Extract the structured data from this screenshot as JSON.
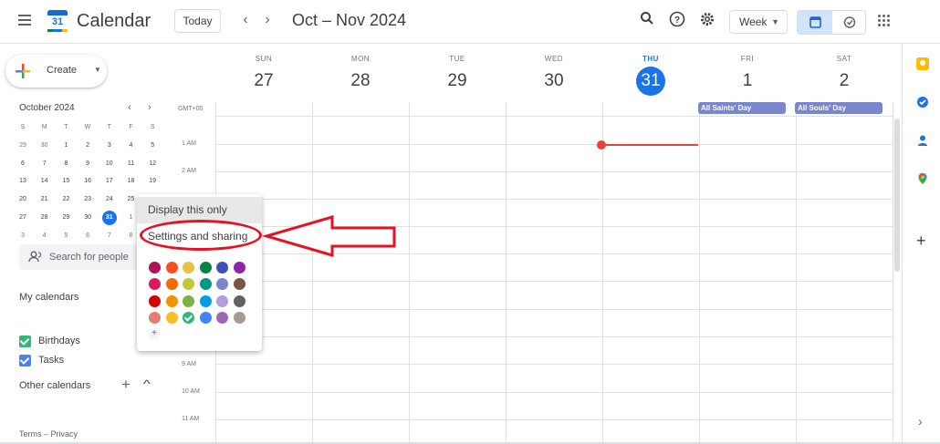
{
  "header": {
    "app_title": "Calendar",
    "logo_number": "31",
    "today_label": "Today",
    "prev_icon": "chevron-left-icon",
    "next_icon": "chevron-right-icon",
    "range_title": "Oct – Nov 2024",
    "search_icon": "search-icon",
    "help_icon": "help-icon",
    "settings_icon": "gear-icon",
    "view_label": "Week",
    "apps_icon": "apps-grid-icon"
  },
  "sidebar": {
    "create_label": "Create",
    "mini_calendar": {
      "month_label": "October 2024",
      "dow": [
        "S",
        "M",
        "T",
        "W",
        "T",
        "F",
        "S"
      ],
      "weeks": [
        [
          "29",
          "30",
          "1",
          "2",
          "3",
          "4",
          "5"
        ],
        [
          "6",
          "7",
          "8",
          "9",
          "10",
          "11",
          "12"
        ],
        [
          "13",
          "14",
          "15",
          "16",
          "17",
          "18",
          "19"
        ],
        [
          "20",
          "21",
          "22",
          "23",
          "24",
          "25",
          ""
        ],
        [
          "27",
          "28",
          "29",
          "30",
          "31",
          "1",
          ""
        ],
        [
          "3",
          "4",
          "5",
          "6",
          "7",
          "8",
          ""
        ]
      ],
      "today": "31"
    },
    "search_people_placeholder": "Search for people",
    "my_calendars_title": "My calendars",
    "calendars": [
      {
        "label": "Birthdays",
        "color": "#33b679"
      },
      {
        "label": "Tasks",
        "color": "#4285f4"
      }
    ],
    "other_calendars_title": "Other calendars",
    "footer": "Terms – Privacy"
  },
  "week": {
    "timezone": "GMT+00",
    "days": [
      {
        "dow": "SUN",
        "num": "27"
      },
      {
        "dow": "MON",
        "num": "28"
      },
      {
        "dow": "TUE",
        "num": "29"
      },
      {
        "dow": "WED",
        "num": "30"
      },
      {
        "dow": "THU",
        "num": "31",
        "today": true
      },
      {
        "dow": "FRI",
        "num": "1"
      },
      {
        "dow": "SAT",
        "num": "2"
      }
    ],
    "all_day_events": [
      {
        "day": "FRI",
        "title": "All Saints' Day"
      },
      {
        "day": "SAT",
        "title": "All Souls' Day"
      }
    ],
    "time_labels": [
      "1 AM",
      "2 AM",
      "9 AM",
      "10 AM",
      "11 AM"
    ]
  },
  "popup": {
    "item1": "Display this only",
    "item2": "Settings and sharing",
    "swatches": [
      [
        "#ad1457",
        "#f4511e",
        "#e4c441",
        "#0b8043",
        "#3f51b5",
        "#8e24aa"
      ],
      [
        "#d81b60",
        "#ef6c00",
        "#c0ca33",
        "#009688",
        "#7986cb",
        "#795548"
      ],
      [
        "#d50000",
        "#f09300",
        "#7cb342",
        "#039be5",
        "#b39ddb",
        "#616161"
      ],
      [
        "#e67c73",
        "#f6bf26",
        "#33b679",
        "#4285f4",
        "#9e69af",
        "#a79b8e"
      ]
    ],
    "selected_swatch": "#33b679"
  },
  "rail_icons": [
    "keep-icon",
    "tasks-icon",
    "contacts-icon",
    "maps-icon",
    "add-icon"
  ]
}
